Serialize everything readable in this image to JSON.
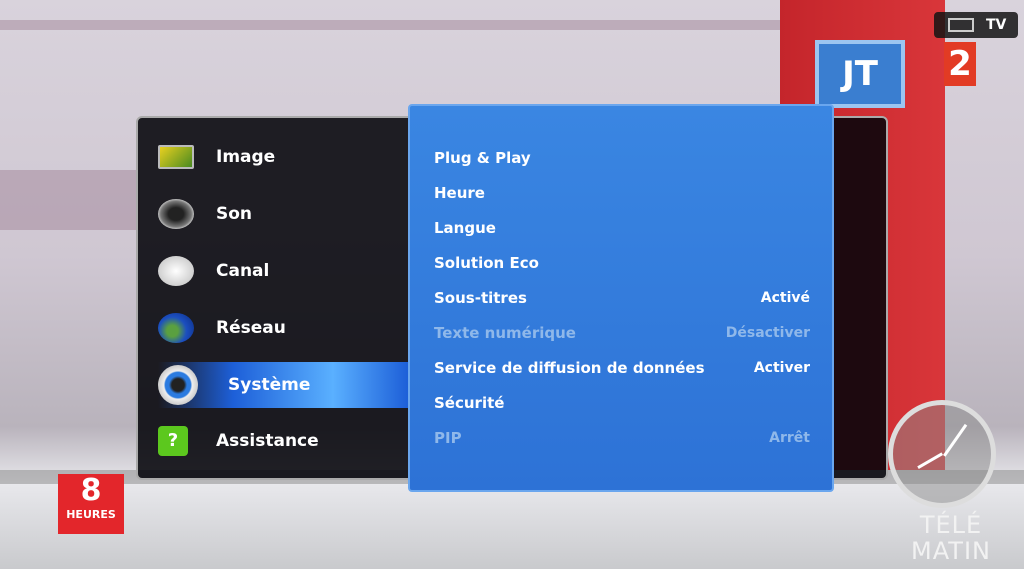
{
  "source_indicator": {
    "icon": "tv-screen-icon",
    "label": "TV"
  },
  "broadcast_logos": {
    "channel": "2",
    "news": "JT",
    "show": "8",
    "show_sub": "HEURES",
    "program": "TÉLÉ MATIN"
  },
  "main_menu": {
    "items": [
      {
        "label": "Image",
        "icon": "picture-icon"
      },
      {
        "label": "Son",
        "icon": "speaker-icon"
      },
      {
        "label": "Canal",
        "icon": "satellite-dish-icon"
      },
      {
        "label": "Réseau",
        "icon": "globe-icon"
      },
      {
        "label": "Système",
        "icon": "gear-icon",
        "selected": true
      },
      {
        "label": "Assistance",
        "icon": "help-icon"
      }
    ]
  },
  "system_menu": {
    "items": [
      {
        "label": "Plug & Play",
        "value": "",
        "enabled": true
      },
      {
        "label": "Heure",
        "value": "",
        "enabled": true
      },
      {
        "label": "Langue",
        "value": "",
        "enabled": true
      },
      {
        "label": "Solution Eco",
        "value": "",
        "enabled": true
      },
      {
        "label": "Sous-titres",
        "value": "Activé",
        "enabled": true
      },
      {
        "label": "Texte numérique",
        "value": "Désactiver",
        "enabled": false
      },
      {
        "label": "Service de diffusion de données",
        "value": "Activer",
        "enabled": true
      },
      {
        "label": "Sécurité",
        "value": "",
        "enabled": true
      },
      {
        "label": "PIP",
        "value": "Arrêt",
        "enabled": false
      }
    ]
  },
  "colors": {
    "submenu_bg": "#2f78da",
    "highlight": "#3f95f5",
    "disabled_text": "#8fb8ea"
  }
}
